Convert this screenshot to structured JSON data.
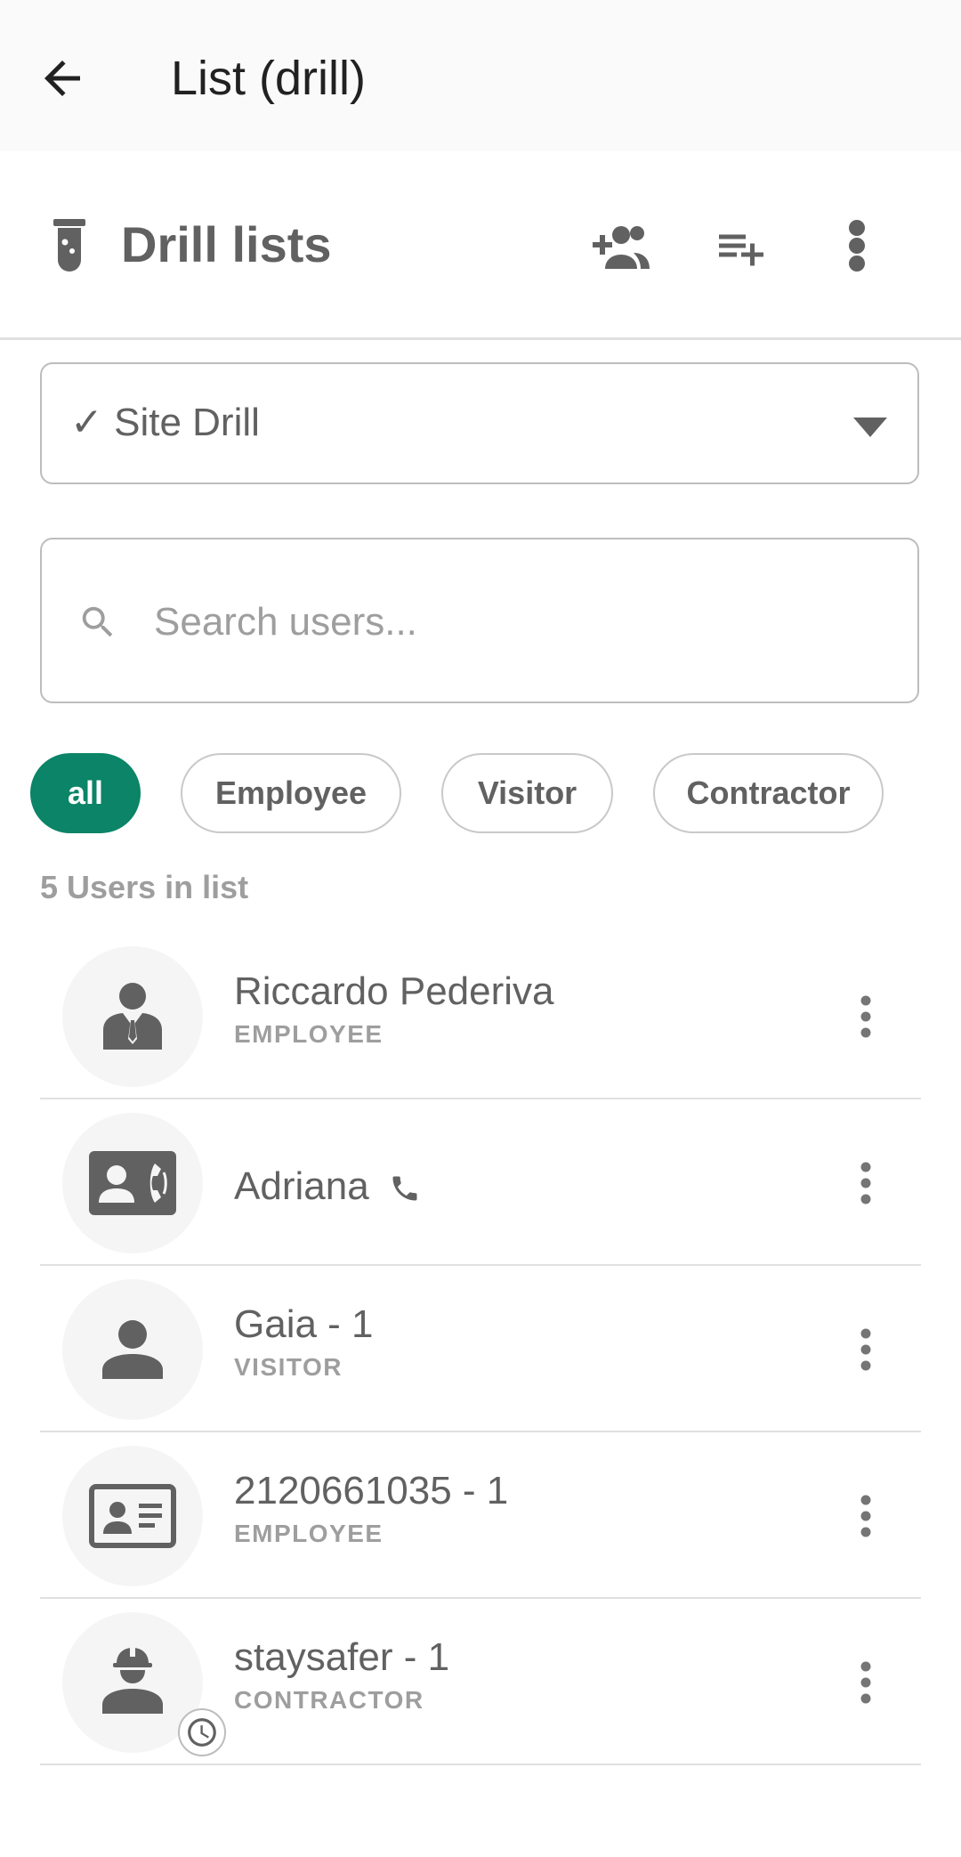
{
  "appbar": {
    "title": "List (drill)"
  },
  "section": {
    "title": "Drill lists"
  },
  "dropdown": {
    "selected": "✓ Site Drill"
  },
  "search": {
    "placeholder": "Search users..."
  },
  "filters": [
    "all",
    "Employee",
    "Visitor",
    "Contractor"
  ],
  "active_filter": "all",
  "count_label": "5 Users in list",
  "users": [
    {
      "name": "Riccardo Pederiva",
      "type": "EMPLOYEE",
      "icon": "employee-tie-icon"
    },
    {
      "name": "Adriana",
      "type": "",
      "icon": "contact-phone-icon",
      "has_phone": true
    },
    {
      "name": "Gaia - 1",
      "type": "VISITOR",
      "icon": "person-icon"
    },
    {
      "name": "2120661035 - 1",
      "type": "EMPLOYEE",
      "icon": "id-card-icon"
    },
    {
      "name": "staysafer - 1",
      "type": "CONTRACTOR",
      "icon": "hard-hat-worker-icon",
      "pending": true
    }
  ],
  "colors": {
    "accent": "#0b8467",
    "text": "#616161",
    "muted": "#9e9e9e",
    "divider": "#e0e0e0"
  }
}
